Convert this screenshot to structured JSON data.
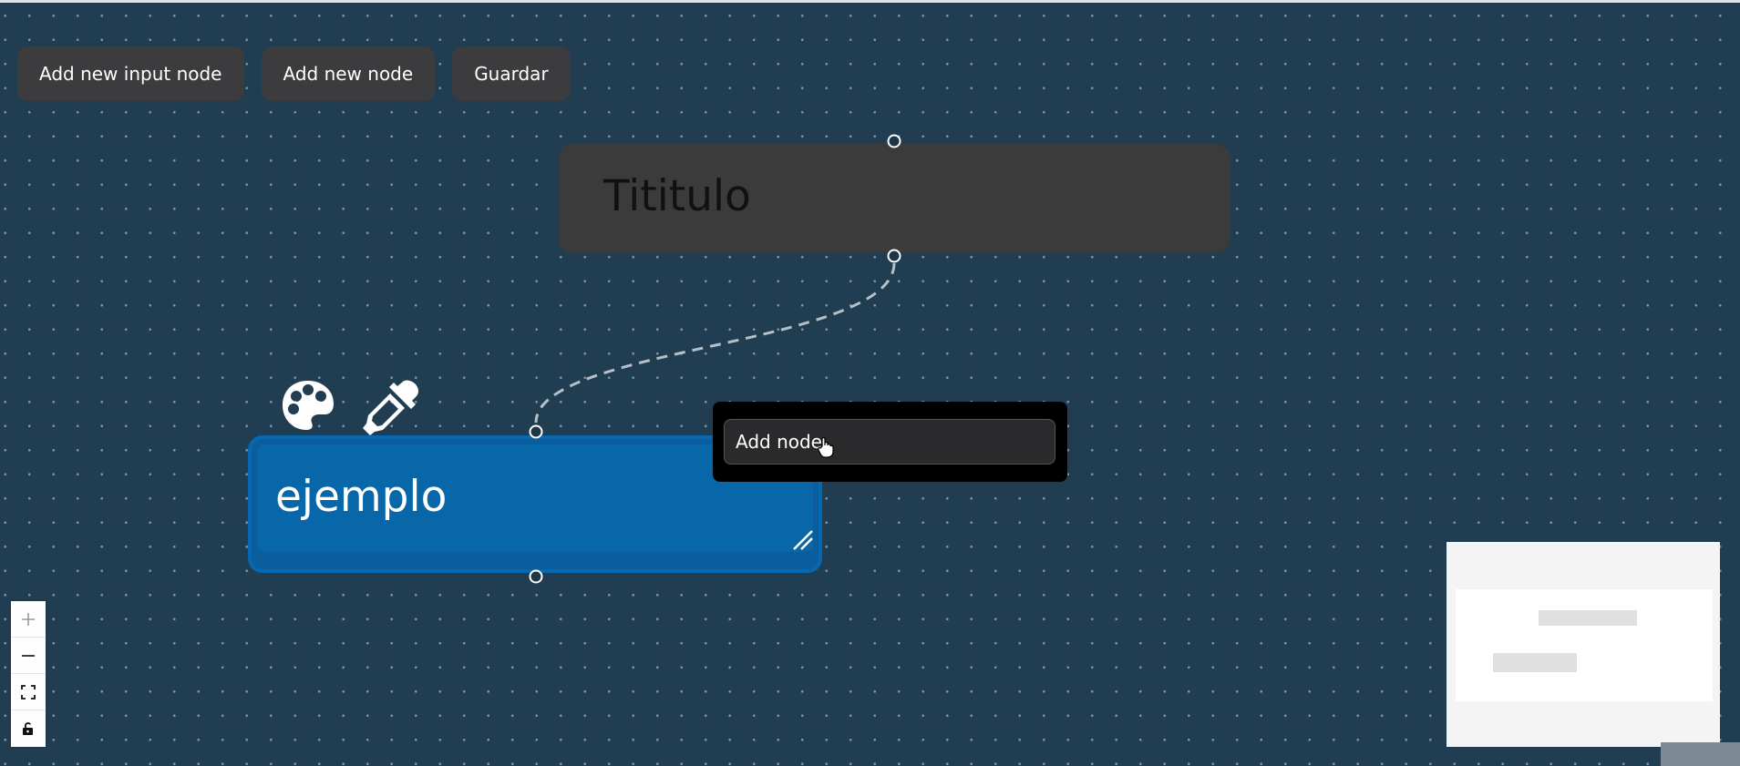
{
  "toolbar": {
    "add_input_node_label": "Add new input node",
    "add_node_label": "Add new node",
    "save_label": "Guardar"
  },
  "nodes": {
    "title_node": {
      "label": "Tititulo",
      "color": "#3b3b3b"
    },
    "example_node": {
      "label": "ejemplo",
      "color": "#0867a8"
    }
  },
  "node_toolbar": {
    "icons": [
      "palette-icon",
      "eyedropper-icon"
    ]
  },
  "popup": {
    "input_value": "Add node"
  },
  "controls": {
    "icons": [
      "zoom-in-icon",
      "zoom-out-icon",
      "fit-view-icon",
      "lock-icon"
    ]
  },
  "colors": {
    "canvas": "#203d52",
    "accent": "#0668b0"
  }
}
